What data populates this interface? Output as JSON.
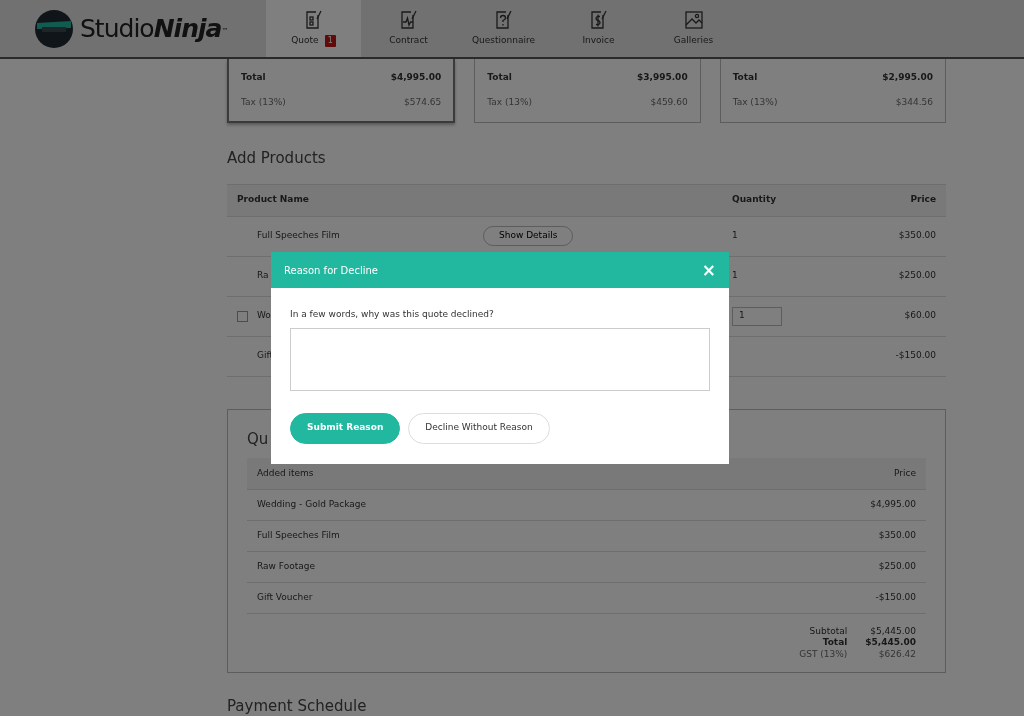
{
  "brand": {
    "light": "Studio",
    "bold": "Ninja",
    "mark": "™"
  },
  "nav": [
    {
      "label": "Quote",
      "badge": "1",
      "selected": true
    },
    {
      "label": "Contract",
      "selected": false
    },
    {
      "label": "Questionnaire",
      "selected": false
    },
    {
      "label": "Invoice",
      "selected": false
    },
    {
      "label": "Galleries",
      "selected": false
    }
  ],
  "packages": [
    {
      "selected": true,
      "total_label": "Total",
      "total": "$4,995.00",
      "tax_label": "Tax (13%)",
      "tax": "$574.65"
    },
    {
      "selected": false,
      "total_label": "Total",
      "total": "$3,995.00",
      "tax_label": "Tax (13%)",
      "tax": "$459.60"
    },
    {
      "selected": false,
      "total_label": "Total",
      "total": "$2,995.00",
      "tax_label": "Tax (13%)",
      "tax": "$344.56"
    }
  ],
  "add_products": {
    "title": "Add Products",
    "columns": [
      "Product Name",
      "Quantity",
      "Price"
    ],
    "rows": [
      {
        "kind": "fixed",
        "name": "Full Speeches Film",
        "details": "Show Details",
        "quantity": "1",
        "price": "$350.00"
      },
      {
        "kind": "fixed",
        "name": "Ra",
        "quantity": "1",
        "price": "$250.00"
      },
      {
        "kind": "optional",
        "checked": false,
        "name": "Wo",
        "quantity": "1",
        "price": "$60.00"
      },
      {
        "kind": "fixed",
        "name": "Gift",
        "price": "-$150.00"
      }
    ]
  },
  "summary": {
    "title": "Qu",
    "columns": [
      "Added items",
      "Price"
    ],
    "rows": [
      {
        "name": "Wedding - Gold Package",
        "price": "$4,995.00"
      },
      {
        "name": "Full Speeches Film",
        "price": "$350.00"
      },
      {
        "name": "Raw Footage",
        "price": "$250.00"
      },
      {
        "name": "Gift Voucher",
        "price": "-$150.00"
      }
    ],
    "totals": [
      {
        "kind": "normal",
        "label": "Subtotal",
        "value": "$5,445.00"
      },
      {
        "kind": "bold",
        "label": "Total",
        "value": "$5,445.00"
      },
      {
        "kind": "muted",
        "label": "GST (13%)",
        "value": "$626.42"
      }
    ]
  },
  "next_section": "Payment Schedule",
  "modal": {
    "title": "Reason for Decline",
    "close": "×",
    "prompt": "In a few words, why was this quote declined?",
    "buttons": [
      {
        "kind": "primary",
        "label": "Submit Reason"
      },
      {
        "kind": "outline",
        "label": "Decline Without Reason"
      }
    ]
  }
}
